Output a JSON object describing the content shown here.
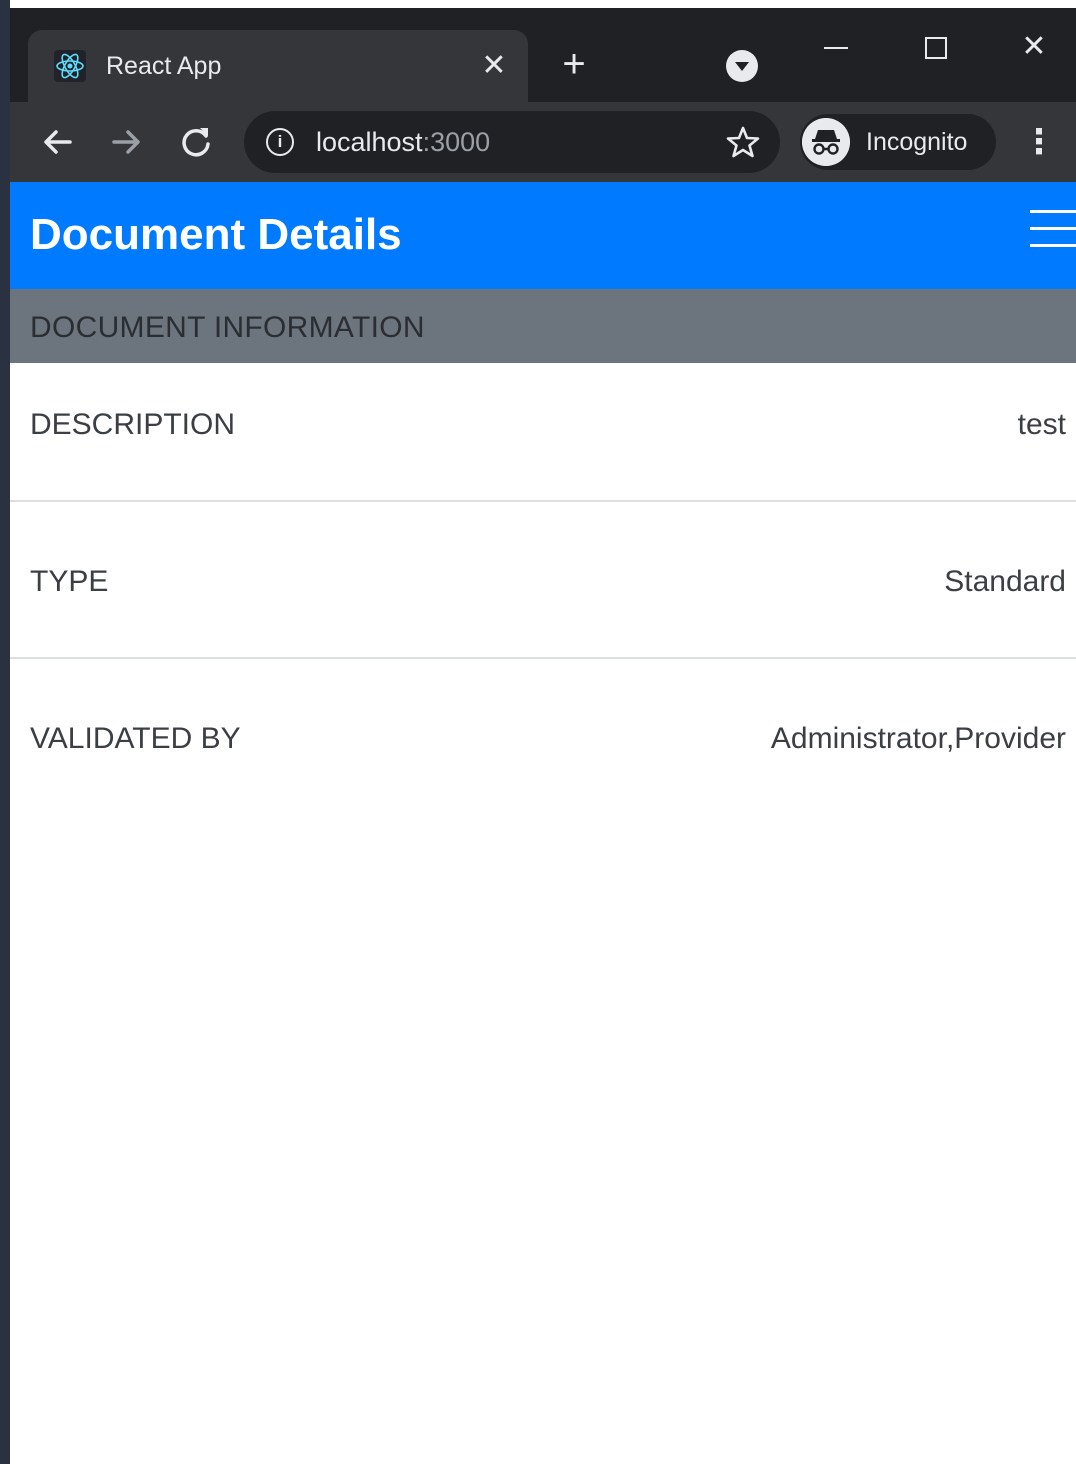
{
  "browser": {
    "tab": {
      "title": "React App",
      "favicon": "react-atom-icon"
    },
    "new_tab_icon": "+",
    "tab_close_icon": "✕",
    "window_close_icon": "✕",
    "url_host": "localhost",
    "url_port": ":3000",
    "incognito_label": "Incognito",
    "colors": {
      "frame": "#202124",
      "toolbar": "#35363a",
      "text": "#e8eaed"
    }
  },
  "navbar": {
    "brand": "Document Details",
    "color": "#007bff"
  },
  "section": {
    "title": "DOCUMENT INFORMATION",
    "color": "#6c757d"
  },
  "details": [
    {
      "label": "DESCRIPTION",
      "value": "test"
    },
    {
      "label": "TYPE",
      "value": "Standard"
    },
    {
      "label": "VALIDATED BY",
      "value": "Administrator,Provider"
    }
  ]
}
